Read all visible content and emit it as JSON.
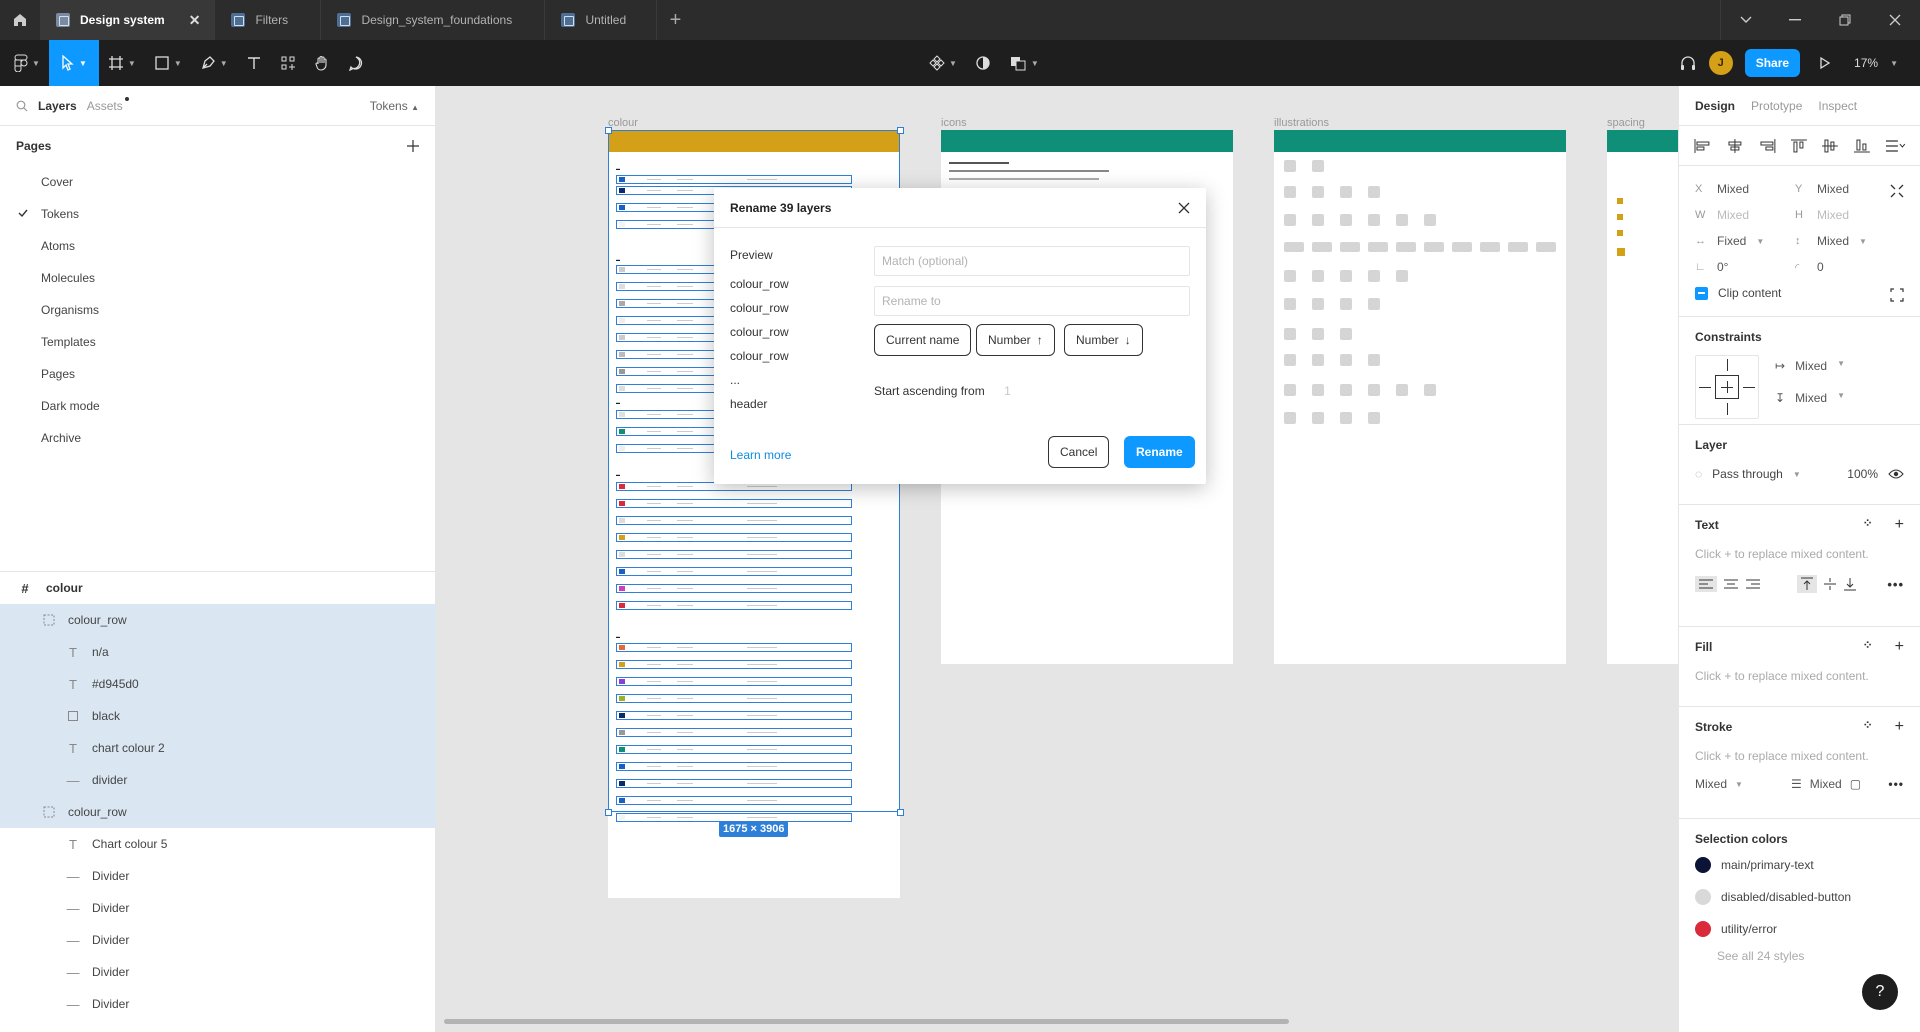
{
  "tabs": [
    {
      "label": "Design system",
      "active": true
    },
    {
      "label": "Filters",
      "active": false
    },
    {
      "label": "Design_system_foundations",
      "active": false
    },
    {
      "label": "Untitled",
      "active": false
    }
  ],
  "toolbar": {
    "share_label": "Share",
    "zoom": "17%",
    "avatar_initial": "J"
  },
  "left_panel": {
    "tab_layers": "Layers",
    "tab_assets": "Assets",
    "tokens_label": "Tokens",
    "pages_title": "Pages",
    "pages": [
      "Cover",
      "Tokens",
      "Atoms",
      "Molecules",
      "Organisms",
      "Templates",
      "Pages",
      "Dark mode",
      "Archive"
    ],
    "current_page": "Tokens",
    "layers": {
      "frame": "colour",
      "row1": "colour_row",
      "row1_children": [
        {
          "icon": "text",
          "label": "n/a"
        },
        {
          "icon": "text",
          "label": "#d945d0"
        },
        {
          "icon": "rect",
          "label": "black"
        },
        {
          "icon": "text",
          "label": "chart colour 2"
        },
        {
          "icon": "line",
          "label": "divider"
        }
      ],
      "row2": "colour_row",
      "row2_children": [
        {
          "icon": "text",
          "label": "Chart colour 5"
        },
        {
          "icon": "line",
          "label": "Divider"
        },
        {
          "icon": "line",
          "label": "Divider"
        },
        {
          "icon": "line",
          "label": "Divider"
        },
        {
          "icon": "line",
          "label": "Divider"
        },
        {
          "icon": "line",
          "label": "Divider"
        }
      ]
    }
  },
  "canvas": {
    "boards": [
      "colour",
      "icons",
      "illustrations",
      "spacing"
    ],
    "dimension_badge": "1675 × 3906",
    "colors": {
      "colour_header": "#d4a017",
      "teal_header": "#0f8f77"
    }
  },
  "modal": {
    "title": "Rename 39 layers",
    "preview_label": "Preview",
    "preview_items": [
      "colour_row",
      "colour_row",
      "colour_row",
      "colour_row",
      "...",
      "header"
    ],
    "match_placeholder": "Match (optional)",
    "rename_placeholder": "Rename to",
    "chip_current": "Current name",
    "chip_number_up": "Number",
    "chip_number_down": "Number",
    "start_label": "Start ascending from",
    "start_value": "1",
    "learn_more": "Learn more",
    "cancel": "Cancel",
    "rename": "Rename"
  },
  "right_panel": {
    "tab_design": "Design",
    "tab_prototype": "Prototype",
    "tab_inspect": "Inspect",
    "x_label": "X",
    "x_value": "Mixed",
    "y_label": "Y",
    "y_value": "Mixed",
    "w_label": "W",
    "w_value": "Mixed",
    "h_label": "H",
    "h_value": "Mixed",
    "width_mode": "Fixed",
    "height_mode": "Mixed",
    "rotation": "0°",
    "radius": "0",
    "clip_content": "Clip content",
    "constraints_title": "Constraints",
    "constraint_h": "Mixed",
    "constraint_v": "Mixed",
    "layer_title": "Layer",
    "blend": "Pass through",
    "opacity": "100%",
    "text_title": "Text",
    "text_hint": "Click + to replace mixed content.",
    "fill_title": "Fill",
    "fill_hint": "Click + to replace mixed content.",
    "stroke_title": "Stroke",
    "stroke_hint": "Click + to replace mixed content.",
    "stroke_pos": "Mixed",
    "stroke_weight": "Mixed",
    "selection_colors_title": "Selection colors",
    "selection_colors": [
      {
        "name": "main/primary-text",
        "color": "#0b1437"
      },
      {
        "name": "disabled/disabled-button",
        "color": "#d9d9d9"
      },
      {
        "name": "utility/error",
        "color": "#d92b3a"
      }
    ],
    "see_all": "See all 24 styles",
    "help": "?"
  }
}
